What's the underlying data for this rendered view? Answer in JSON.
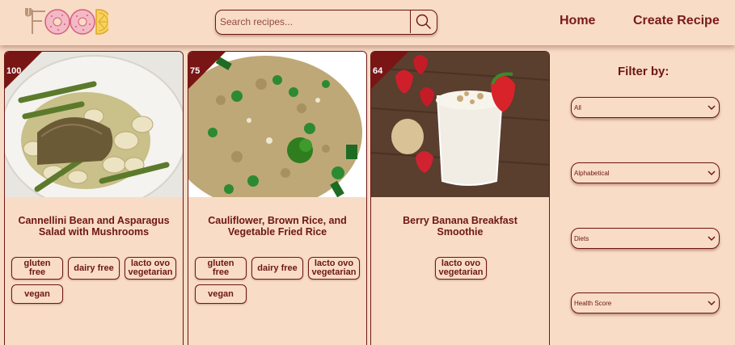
{
  "search": {
    "placeholder": "Search recipes..."
  },
  "nav": {
    "home": "Home",
    "create": "Create Recipe"
  },
  "recipes": [
    {
      "score": "100",
      "title": "Cannellini Bean and Asparagus Salad with Mushrooms",
      "diets": [
        "gluten free",
        "dairy free",
        "lacto ovo vegetarian",
        "vegan"
      ]
    },
    {
      "score": "75",
      "title": "Cauliflower, Brown Rice, and Vegetable Fried Rice",
      "diets": [
        "gluten free",
        "dairy free",
        "lacto ovo vegetarian",
        "vegan"
      ]
    },
    {
      "score": "64",
      "title": "Berry Banana Breakfast Smoothie",
      "diets": [
        "lacto ovo vegetarian"
      ]
    }
  ],
  "sidebar": {
    "title": "Filter by:",
    "filters": [
      "All",
      "Alphabetical",
      "Diets",
      "Health Score"
    ]
  },
  "colors": {
    "accent": "#6e1616",
    "background": "#f8dcc6",
    "score_badge": "#7a1515"
  }
}
